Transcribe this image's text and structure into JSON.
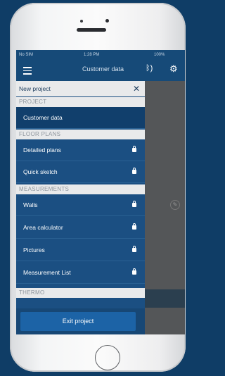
{
  "statusbar": {
    "carrier": "No SIM",
    "time": "1:28 PM",
    "battery": "100%"
  },
  "appbar": {
    "title": "Customer data",
    "menu_icon": "hamburger-icon",
    "bt_icon": "bluetooth-icon",
    "gear_icon": "gear-icon"
  },
  "drawer": {
    "title": "New project",
    "sections": {
      "project": "PROJECT",
      "floor_plans": "FLOOR PLANS",
      "measurements": "MEASUREMENTS",
      "thermo": "THERMO"
    },
    "items": {
      "customer_data": "Customer data",
      "detailed_plans": "Detailed plans",
      "quick_sketch": "Quick sketch",
      "walls": "Walls",
      "area_calculator": "Area calculator",
      "pictures": "Pictures",
      "measurement_list": "Measurement List"
    },
    "exit_label": "Exit project"
  },
  "colors": {
    "background": "#0f3d66",
    "drawer": "#1b4f82",
    "active_item": "#113f6c",
    "exit_button": "#1c63a6",
    "section_bg": "#e9eaeb"
  }
}
